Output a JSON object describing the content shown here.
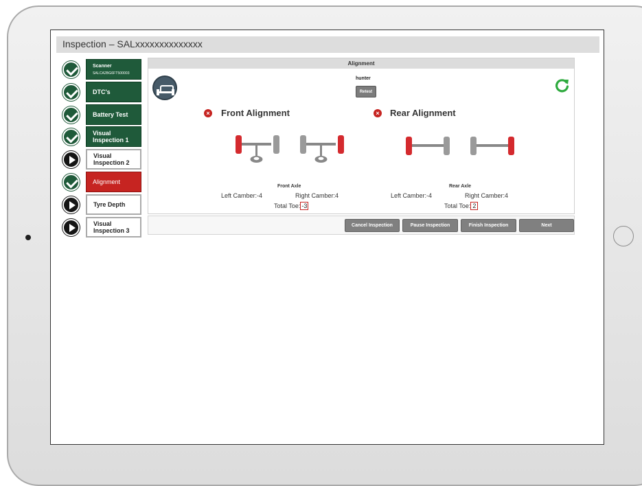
{
  "page": {
    "title": "Inspection – SALxxxxxxxxxxxxxx"
  },
  "sidebar": {
    "steps": [
      {
        "label": "Scanner",
        "sub": "SALCA2BG6FT500003",
        "status": "done",
        "style": "green"
      },
      {
        "label": "DTC's",
        "status": "done",
        "style": "green"
      },
      {
        "label": "Battery Test",
        "status": "done",
        "style": "green"
      },
      {
        "label": "Visual Inspection 1",
        "status": "done",
        "style": "green"
      },
      {
        "label": "Visual Inspection 2",
        "status": "pending",
        "style": "white"
      },
      {
        "label": "Alignment",
        "status": "done",
        "style": "red"
      },
      {
        "label": "Tyre Depth",
        "status": "pending",
        "style": "white"
      },
      {
        "label": "Visual Inspection 3",
        "status": "pending",
        "style": "white"
      }
    ]
  },
  "panel": {
    "heading": "Alignment",
    "brand": "hunter",
    "retest_label": "Retest",
    "front": {
      "title": "Front Alignment",
      "axle_label": "Front Axle",
      "left_camber": "Left Camber:-4",
      "right_camber": "Right Camber:4",
      "total_toe_label": "Total Toe:",
      "total_toe_value": "-3"
    },
    "rear": {
      "title": "Rear Alignment",
      "axle_label": "Rear Axle",
      "left_camber": "Left Camber:-4",
      "right_camber": "Right Camber:4",
      "total_toe_label": "Total Toe:",
      "total_toe_value": "2"
    }
  },
  "footer": {
    "cancel": "Cancel Inspection",
    "pause": "Pause Inspection",
    "finish": "Finish Inspection",
    "next": "Next"
  },
  "colors": {
    "done_green": "#1f5a3a",
    "alert_red": "#c62421",
    "button_gray": "#808080",
    "refresh_green": "#2eaa3e"
  },
  "icons": {
    "step_done": "check-circle-icon",
    "step_pending": "play-circle-icon",
    "error": "error-x-icon",
    "refresh": "refresh-icon",
    "logo": "hunter-logo-icon"
  }
}
